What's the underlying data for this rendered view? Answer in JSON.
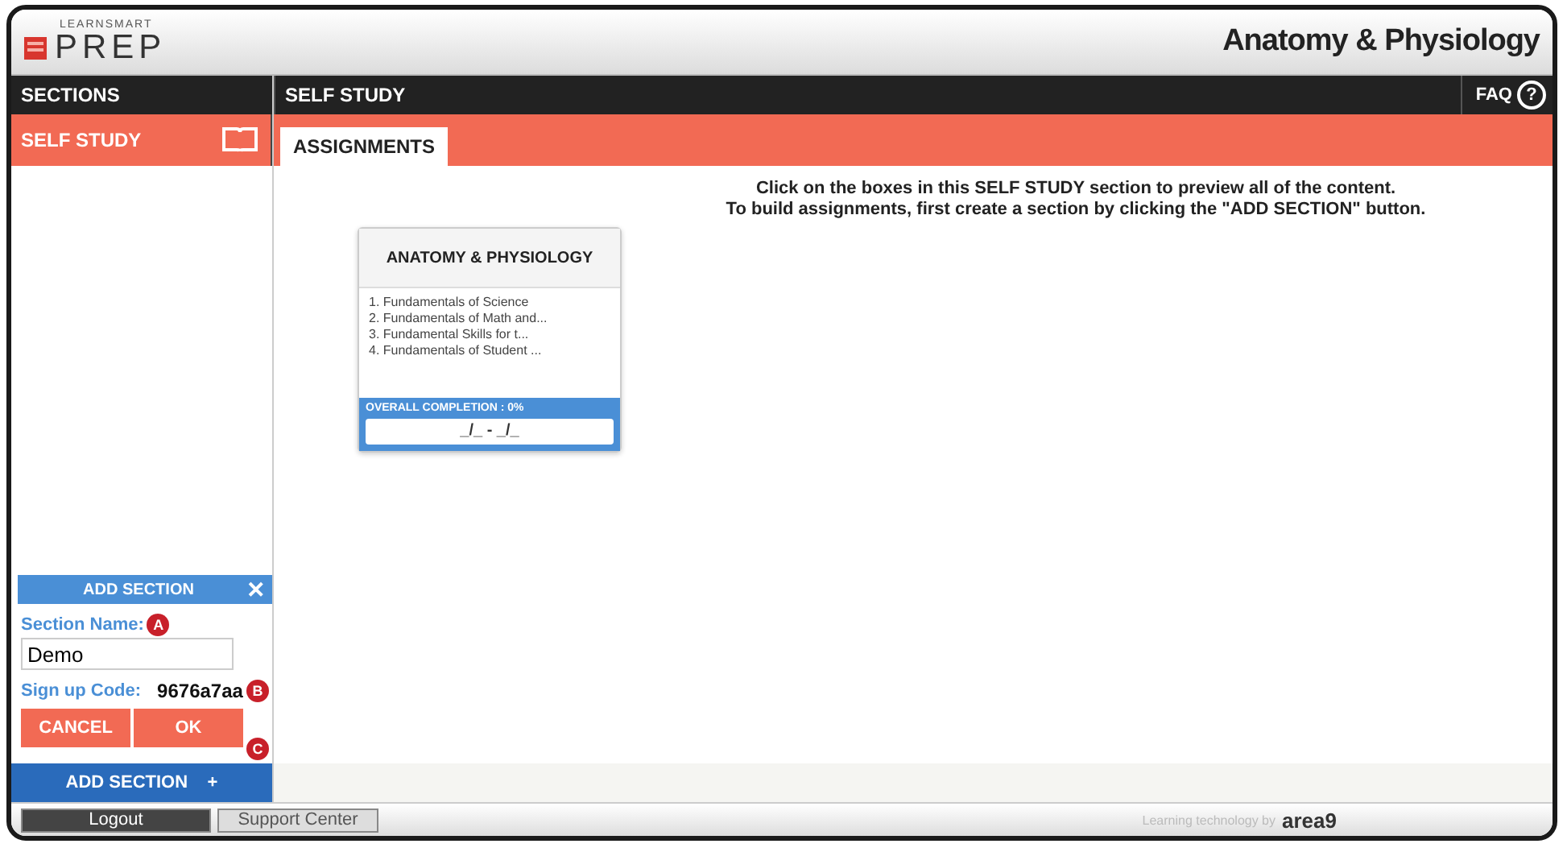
{
  "header": {
    "brand_small": "LEARNSMART",
    "brand": "PREP",
    "course_title": "Anatomy & Physiology"
  },
  "sidebar": {
    "title": "SECTIONS",
    "items": [
      {
        "label": "SELF STUDY",
        "selected": true
      }
    ],
    "add_panel": {
      "title": "ADD SECTION",
      "close": "✕",
      "name_label": "Section Name:",
      "name_callout": "A",
      "name_value": "Demo",
      "code_label": "Sign up Code:",
      "code_value": "9676a7aa",
      "code_callout": "B",
      "buttons": [
        "CANCEL",
        "OK"
      ],
      "buttons_callout": "C"
    },
    "add_button": {
      "label": "ADD SECTION",
      "icon": "+"
    }
  },
  "main": {
    "title": "SELF STUDY",
    "faq": "FAQ",
    "faq_icon": "?",
    "tabs": [
      {
        "label": "ASSIGNMENTS",
        "selected": true
      }
    ],
    "instructions": [
      "Click on the boxes in this SELF STUDY section to preview all of the content.",
      "To build assignments, first create a section by clicking the \"ADD SECTION\" button."
    ],
    "cards": [
      {
        "title": "ANATOMY & PHYSIOLOGY",
        "topics": [
          "1. Fundamentals of Science",
          "2. Fundamentals of Math and...",
          "3. Fundamental Skills for t...",
          "4. Fundamentals of Student ..."
        ],
        "completion": "OVERALL COMPLETION : 0%",
        "dates": "_/_ - _/_"
      }
    ]
  },
  "footer": {
    "buttons": [
      "Logout",
      "Support Center"
    ],
    "credit": "Learning technology by",
    "credit_brand": "area9"
  }
}
